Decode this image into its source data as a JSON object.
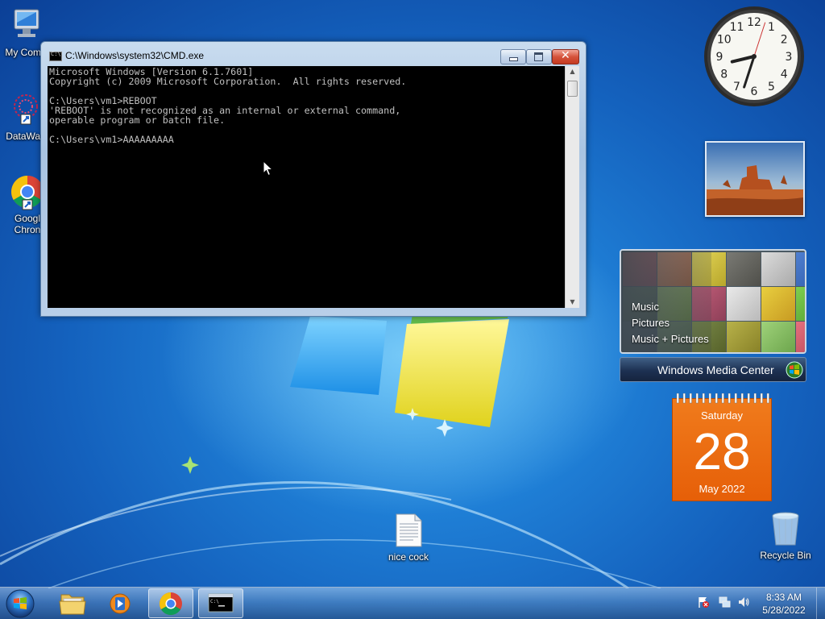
{
  "desktop": {
    "icons": [
      {
        "label": "My Comp",
        "icon": "computer-icon"
      },
      {
        "label": "DataWag",
        "icon": "datawag-shortcut-icon"
      },
      {
        "label": "Googl",
        "label2": "Chron",
        "icon": "chrome-shortcut-icon"
      },
      {
        "label": "nice cock",
        "icon": "text-file-icon"
      },
      {
        "label": "Recycle Bin",
        "icon": "recycle-bin-icon"
      }
    ]
  },
  "cmd_window": {
    "title": "C:\\Windows\\system32\\CMD.exe",
    "lines": [
      "Microsoft Windows [Version 6.1.7601]",
      "Copyright (c) 2009 Microsoft Corporation.  All rights reserved.",
      "",
      "C:\\Users\\vm1>REBOOT",
      "'REBOOT' is not recognized as an internal or external command,",
      "operable program or batch file.",
      "",
      "C:\\Users\\vm1>AAAAAAAAA"
    ],
    "buttons": {
      "minimize": "minimize",
      "maximize": "maximize",
      "close": "close"
    }
  },
  "gadgets": {
    "clock": {
      "numerals": [
        "12",
        "1",
        "2",
        "3",
        "4",
        "5",
        "6",
        "7",
        "8",
        "9",
        "10",
        "11"
      ],
      "time": "8:33"
    },
    "media_center": {
      "items": [
        "Music",
        "Pictures",
        "Music + Pictures"
      ],
      "bar_label": "Windows Media Center"
    },
    "calendar": {
      "weekday": "Saturday",
      "day": "28",
      "month_year": "May 2022"
    }
  },
  "taskbar": {
    "pinned": [
      {
        "name": "explorer",
        "icon": "folder-icon",
        "active": false
      },
      {
        "name": "media-player",
        "icon": "media-player-icon",
        "active": false
      },
      {
        "name": "chrome",
        "icon": "chrome-icon",
        "active": true
      },
      {
        "name": "cmd",
        "icon": "cmd-icon",
        "active": true
      }
    ],
    "tray_icons": [
      "action-center-flag-icon",
      "network-icon",
      "volume-icon"
    ],
    "time": "8:33 AM",
    "date": "5/28/2022"
  },
  "colors": {
    "console_bg": "#000000",
    "console_text": "#c0c0c0",
    "calendar_orange": "#e8660c",
    "desktop_blue": "#1461bd"
  }
}
